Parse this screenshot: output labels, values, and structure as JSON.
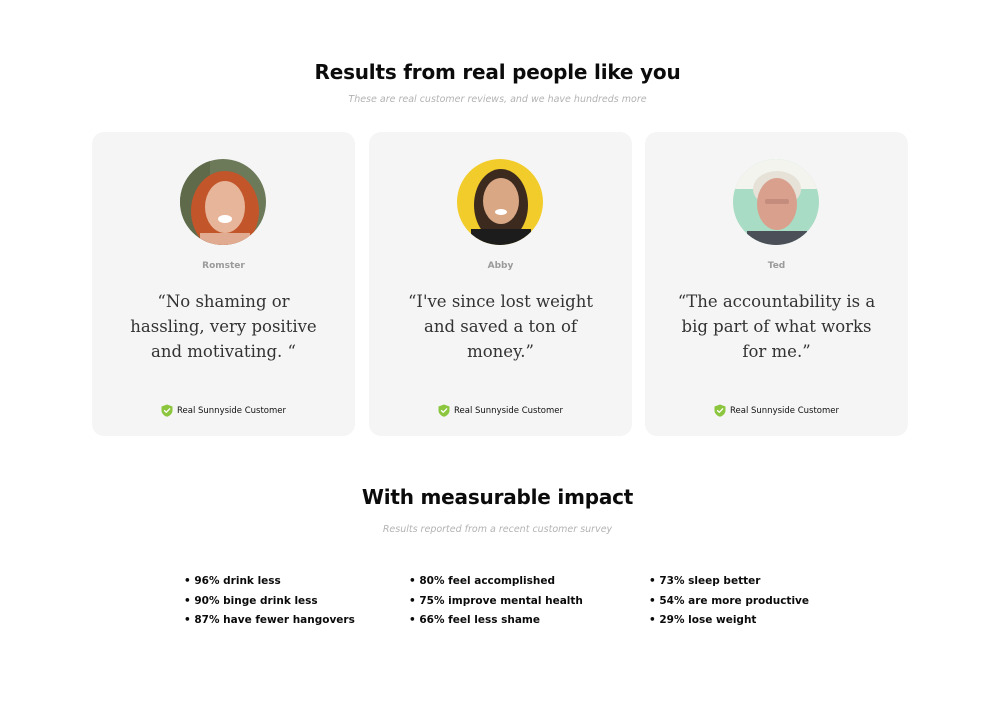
{
  "testimonials": {
    "title": "Results from real people like you",
    "subtitle": "These are real customer reviews, and we have hundreds more",
    "cards": [
      {
        "name": "Romster",
        "quote": "“No shaming or hassling, very positive and motivating. “",
        "badge": "Real Sunnyside Customer",
        "avatar_bg": "#6d7a5a",
        "hair_color": "#c2552a",
        "skin_color": "#e7b59a"
      },
      {
        "name": "Abby",
        "quote": "“I've since lost weight and saved a ton of money.”",
        "badge": "Real Sunnyside Customer",
        "avatar_bg": "#f2cc2b",
        "hair_color": "#3d2a1f",
        "skin_color": "#d9a784"
      },
      {
        "name": "Ted",
        "quote": "“The accountability is a big part of what works for me.”",
        "badge": "Real Sunnyside Customer",
        "avatar_bg": "#a9dcc4",
        "hair_color": "#e6e2d8",
        "skin_color": "#d9a08e"
      }
    ]
  },
  "impact": {
    "title": "With measurable impact",
    "subtitle": "Results reported from a recent customer survey",
    "columns": [
      [
        "96% drink less",
        "90% binge drink less",
        "87% have fewer hangovers"
      ],
      [
        "80% feel accomplished",
        "75% improve mental health",
        "66% feel less shame"
      ],
      [
        "73% sleep better",
        "54% are more productive",
        "29% lose weight"
      ]
    ]
  },
  "colors": {
    "badge_green": "#8cc63f",
    "card_bg": "#f5f5f5"
  }
}
